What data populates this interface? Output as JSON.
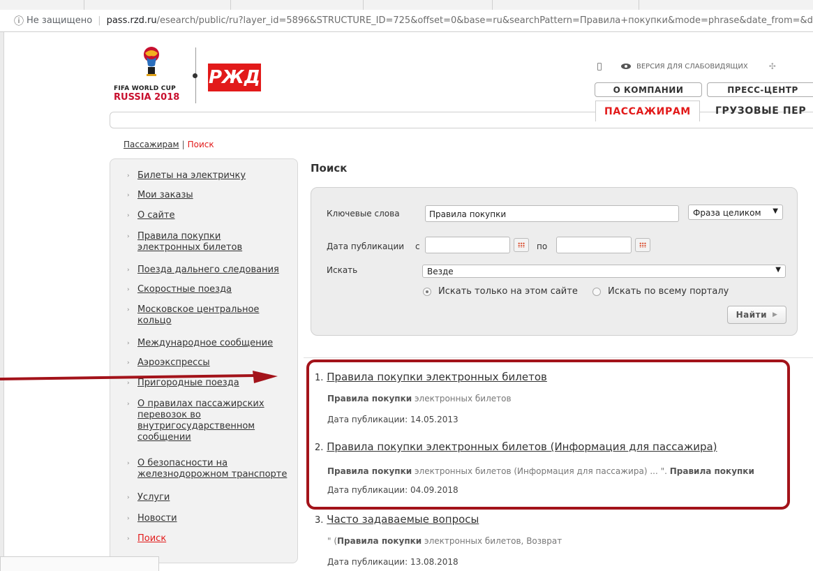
{
  "browser": {
    "security_label": "Не защищено",
    "host": "pass.rzd.ru",
    "path": "/esearch/public/ru?layer_id=5896&STRUCTURE_ID=725&offset=0&base=ru&searchPattern=Правила+покупки&mode=phrase&date_from=&d"
  },
  "header": {
    "fifa_line1": "FIFA WORLD CUP",
    "fifa_line2": "RUSSIA 2018",
    "rzd_logo": "РЖД",
    "accessibility_label": "ВЕРСИЯ ДЛЯ СЛАБОВИДЯЩИХ",
    "btn_company": "О КОМПАНИИ",
    "btn_press": "ПРЕСС-ЦЕНТР",
    "nav_passengers": "ПАССАЖИРАМ",
    "nav_cargo": "ГРУЗОВЫЕ ПЕР"
  },
  "breadcrumb": {
    "parent": "Пассажирам",
    "separator": "|",
    "current": "Поиск"
  },
  "sidebar": {
    "items": [
      {
        "lines": [
          "Билеты на электричку"
        ]
      },
      {
        "lines": [
          "Мои заказы"
        ]
      },
      {
        "lines": [
          "О сайте"
        ]
      },
      {
        "lines": [
          "Правила покупки",
          "электронных билетов"
        ]
      },
      {
        "lines": [
          "Поезда дальнего следования"
        ]
      },
      {
        "lines": [
          "Скоростные поезда"
        ]
      },
      {
        "lines": [
          "Московское центральное",
          "кольцо"
        ]
      },
      {
        "lines": [
          "Международное сообщение"
        ]
      },
      {
        "lines": [
          "Аэроэкспрессы"
        ]
      },
      {
        "lines": [
          "Пригородные поезда"
        ]
      },
      {
        "lines": [
          "О правилах пассажирских",
          "перевозок во",
          "внутригосударственном",
          "сообщении"
        ]
      },
      {
        "lines": [
          "О безопасности на",
          "железнодорожном транспорте"
        ]
      },
      {
        "lines": [
          "Услуги"
        ]
      },
      {
        "lines": [
          "Новости"
        ]
      },
      {
        "lines": [
          "Поиск"
        ]
      }
    ]
  },
  "search": {
    "title": "Поиск",
    "keywords_label": "Ключевые слова",
    "keywords_value": "Правила покупки",
    "mode_value": "Фраза целиком",
    "date_label": "Дата публикации",
    "date_from_label": "с",
    "date_to_label": "по",
    "date_from_value": "",
    "date_to_value": "",
    "scope_label": "Искать",
    "scope_value": "Везде",
    "radio_site": "Искать только на этом сайте",
    "radio_portal": "Искать по всему порталу",
    "find_button": "Найти"
  },
  "results": [
    {
      "num": "1.",
      "title": "Правила покупки электронных билетов",
      "snippet_bold": "Правила покупки",
      "snippet_rest": " электронных билетов",
      "date_label": "Дата публикации:",
      "date": "14.05.2013"
    },
    {
      "num": "2.",
      "title": "Правила покупки электронных билетов (Информация для пассажира)",
      "snippet_bold": "Правила покупки",
      "snippet_rest": " электронных билетов (Информация для пассажира) ... \". ",
      "snippet_bold2": "Правила покупки",
      "date_label": "Дата публикации:",
      "date": "04.09.2018"
    },
    {
      "num": "3.",
      "title": "Часто задаваемые вопросы",
      "snippet_pre": "\" (",
      "snippet_bold": "Правила покупки",
      "snippet_rest": " электронных билетов, Возврат",
      "date_label": "Дата публикации:",
      "date": "13.08.2018"
    }
  ],
  "colors": {
    "brand_red": "#e21a1a",
    "highlight_red": "#a3131a"
  }
}
